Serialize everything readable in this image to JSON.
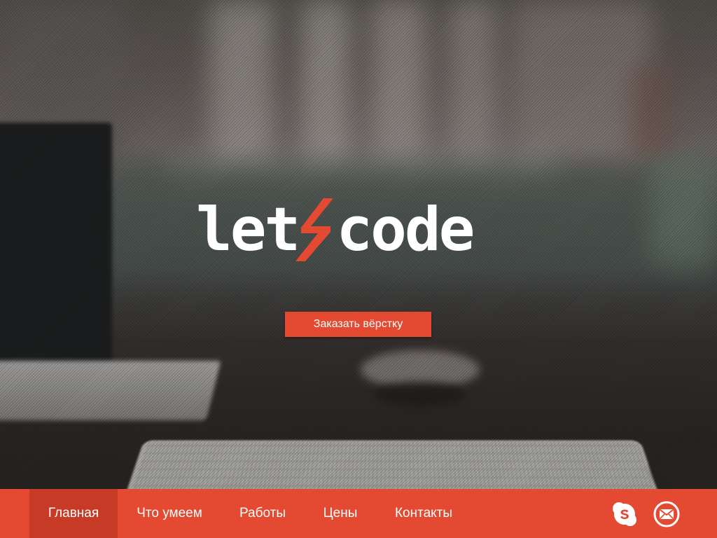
{
  "logo": {
    "left_text": "let",
    "right_text": "code",
    "accent_color": "#e44a32"
  },
  "cta": {
    "label": "Заказать вёрстку"
  },
  "nav": {
    "items": [
      {
        "label": "Главная",
        "active": true
      },
      {
        "label": "Что умеем",
        "active": false
      },
      {
        "label": "Работы",
        "active": false
      },
      {
        "label": "Цены",
        "active": false
      },
      {
        "label": "Контакты",
        "active": false
      }
    ]
  },
  "social": {
    "icons": [
      "skype-icon",
      "mail-icon"
    ]
  },
  "colors": {
    "brand": "#e44a32",
    "active_nav": "#c73a26",
    "text": "#ffffff"
  }
}
